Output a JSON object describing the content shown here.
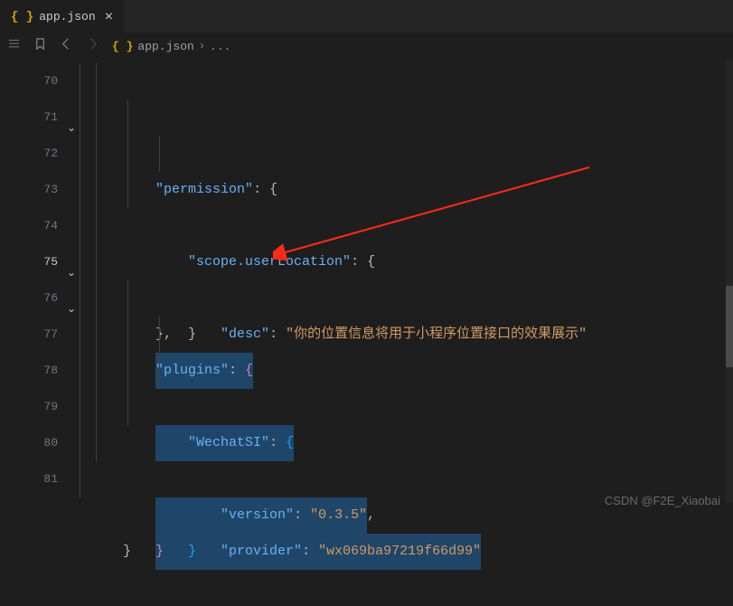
{
  "tab": {
    "filename": "app.json",
    "icon": "braces-icon"
  },
  "breadcrumb": {
    "filename": "app.json"
  },
  "gutter": {
    "lines": [
      "70",
      "71",
      "72",
      "73",
      "74",
      "75",
      "76",
      "77",
      "78",
      "79",
      "80",
      "81"
    ],
    "activeLine": "75"
  },
  "code": {
    "l70": {
      "key": "\"permission\"",
      "after": ": {"
    },
    "l71": {
      "key": "\"scope.userLocation\"",
      "after": ": {"
    },
    "l72": {
      "key": "\"desc\"",
      "sep": ": ",
      "str": "\"你的位置信息将用于小程序位置接口的效果展示\""
    },
    "l73": {
      "brace": "}"
    },
    "l74": {
      "brace": "}",
      "comma": ","
    },
    "l75": {
      "key": "\"plugins\"",
      "sep": ": ",
      "brace": "{"
    },
    "l76": {
      "key": "\"WechatSI\"",
      "sep": ": ",
      "brace": "{"
    },
    "l77": {
      "key": "\"version\"",
      "sep": ": ",
      "str": "\"0.3.5\"",
      "comma": ","
    },
    "l78": {
      "key": "\"provider\"",
      "sep": ": ",
      "str": "\"wx069ba97219f66d99\""
    },
    "l79": {
      "brace": "}"
    },
    "l80": {
      "brace": "}"
    },
    "l81": {
      "brace": "}"
    }
  },
  "watermark": "CSDN @F2E_Xiaobai"
}
